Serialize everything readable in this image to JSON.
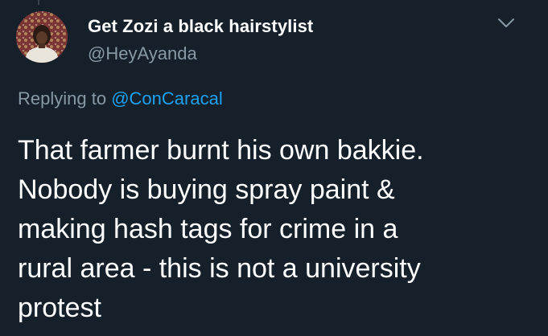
{
  "tweet": {
    "author": {
      "display_name": "Get Zozi a black hairstylist",
      "handle": "@HeyAyanda",
      "avatar_icon": "profile-photo"
    },
    "reply_context": {
      "prefix": "Replying to",
      "mention": "@ConCaracal"
    },
    "text_lines": [
      "That farmer burnt his own bakkie.",
      "Nobody is buying spray paint &",
      "making hash tags for crime in a",
      "rural area - this is not a university",
      "protest"
    ],
    "menu_icon": "chevron-down-icon"
  },
  "colors": {
    "background": "#15202b",
    "primary_text": "#ffffff",
    "secondary_text": "#8899a6",
    "accent": "#1da1f2"
  }
}
